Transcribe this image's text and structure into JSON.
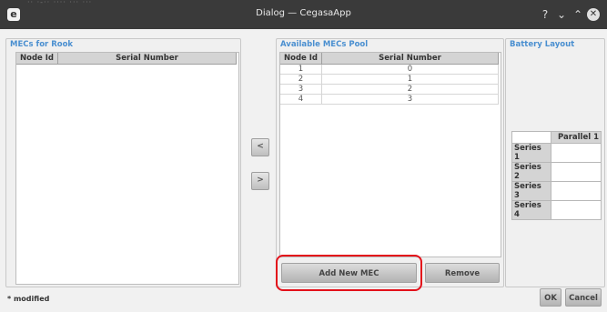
{
  "window": {
    "title": "Dialog — CegasaApp",
    "logo_letter": "e",
    "behind_text": "·· ·-·· ···· ··· ···"
  },
  "window_controls": {
    "help": "?",
    "minimize": "⌄",
    "maximize": "⌃",
    "close": "✕"
  },
  "left_group": {
    "title": "MECs for Rook",
    "columns": [
      "Node Id",
      "Serial Number"
    ]
  },
  "transfer_buttons": {
    "move_left": "<",
    "move_right": ">"
  },
  "pool_group": {
    "title": "Available MECs Pool",
    "columns": [
      "Node Id",
      "Serial Number"
    ],
    "rows": [
      {
        "node_id": "1",
        "serial": "0"
      },
      {
        "node_id": "2",
        "serial": "1"
      },
      {
        "node_id": "3",
        "serial": "2"
      },
      {
        "node_id": "4",
        "serial": "3"
      }
    ],
    "add_button": "Add New MEC",
    "remove_button": "Remove"
  },
  "battery_group": {
    "title": "Battery Layout",
    "column_header": "Parallel 1",
    "rows": [
      "Series 1",
      "Series 2",
      "Series 3",
      "Series 4"
    ]
  },
  "footer": {
    "status": "* modified",
    "ok_button": "OK",
    "cancel_button": "Cancel"
  },
  "colors": {
    "titlebar": "#3a3a3a",
    "group_title": "#4a8fd0",
    "highlight": "#e3101a"
  }
}
